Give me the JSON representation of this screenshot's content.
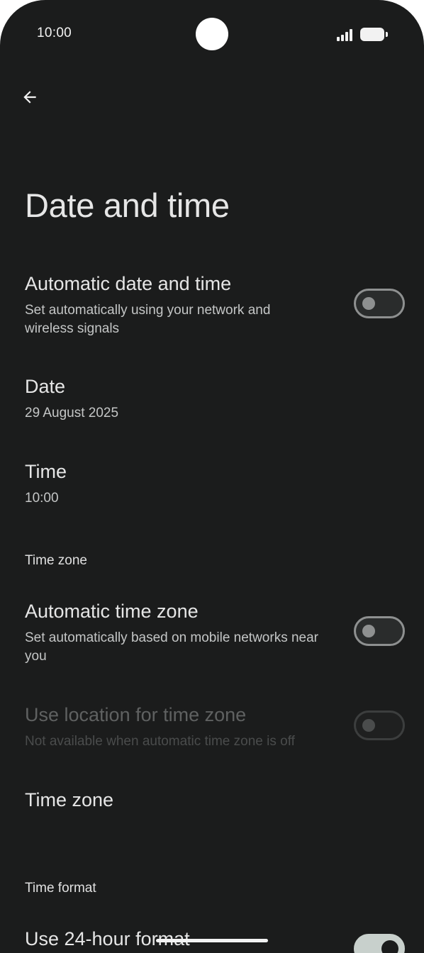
{
  "status_bar": {
    "time": "10:00"
  },
  "header": {
    "back_icon": "arrow-back-icon",
    "title": "Date and time"
  },
  "settings": {
    "auto_date_time": {
      "title": "Automatic date and time",
      "subtitle": "Set automatically using your network and wireless signals",
      "enabled": false
    },
    "date": {
      "title": "Date",
      "value": "29 August 2025"
    },
    "time": {
      "title": "Time",
      "value": "10:00"
    },
    "time_zone_section": "Time zone",
    "auto_time_zone": {
      "title": "Automatic time zone",
      "subtitle": "Set automatically based on mobile networks near you",
      "enabled": false
    },
    "location_time_zone": {
      "title": "Use location for time zone",
      "subtitle": "Not available when automatic time zone is off",
      "enabled": false,
      "available": false
    },
    "time_zone": {
      "title": "Time zone"
    },
    "time_format_section": "Time format",
    "use_24_hour": {
      "title": "Use 24-hour format",
      "enabled": true
    }
  },
  "colors": {
    "background": "#1b1c1c",
    "text_primary": "#e6e6e6",
    "text_secondary": "#c4c6c6",
    "toggle_on": "#c8d0cc"
  }
}
